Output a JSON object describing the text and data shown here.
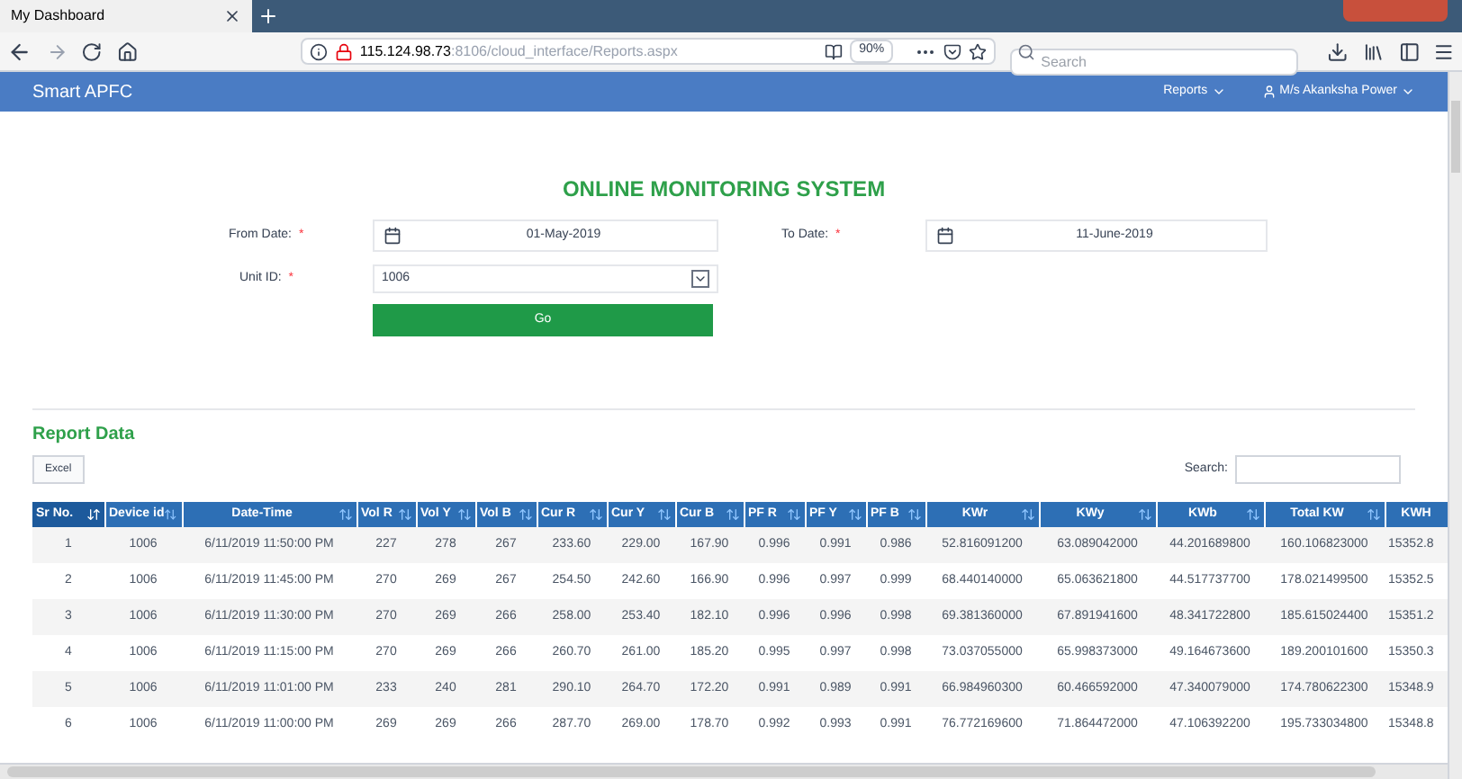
{
  "browser": {
    "tab_title": "My Dashboard",
    "address_host": "115.124.98.73",
    "address_path": ":8106/cloud_interface/Reports.aspx",
    "zoom": "90%",
    "search_placeholder": "Search"
  },
  "navbar": {
    "brand": "Smart APFC",
    "menus": [
      {
        "label": "Reports",
        "kind": "menu"
      },
      {
        "label": "M/s Akanksha Power",
        "kind": "user"
      }
    ]
  },
  "title": "ONLINE MONITORING SYSTEM",
  "form": {
    "from_label": "From Date: ",
    "from_value": "01-May-2019",
    "to_label": "To Date: ",
    "to_value": "11-June-2019",
    "unit_label": "Unit ID: ",
    "unit_value": "1006",
    "required_mark": "*",
    "go": "Go"
  },
  "report": {
    "heading": "Report Data",
    "excel": "Excel",
    "search_label": "Search:"
  },
  "table": {
    "columns": [
      {
        "label": "Sr No.",
        "sorted": true
      },
      {
        "label": "Device id",
        "sorted": false
      },
      {
        "label": "Date-Time",
        "sorted": false
      },
      {
        "label": "Vol R",
        "sorted": false
      },
      {
        "label": "Vol Y",
        "sorted": false
      },
      {
        "label": "Vol B",
        "sorted": false
      },
      {
        "label": "Cur R",
        "sorted": false
      },
      {
        "label": "Cur Y",
        "sorted": false
      },
      {
        "label": "Cur B",
        "sorted": false
      },
      {
        "label": "PF R",
        "sorted": false
      },
      {
        "label": "PF Y",
        "sorted": false
      },
      {
        "label": "PF B",
        "sorted": false
      },
      {
        "label": "KWr",
        "sorted": false
      },
      {
        "label": "KWy",
        "sorted": false
      },
      {
        "label": "KWb",
        "sorted": false
      },
      {
        "label": "Total KW",
        "sorted": false
      },
      {
        "label": "KWH"
      }
    ],
    "rows": [
      [
        "1",
        "1006",
        "6/11/2019 11:50:00 PM",
        "227",
        "278",
        "267",
        "233.60",
        "229.00",
        "167.90",
        "0.996",
        "0.991",
        "0.986",
        "52.816091200",
        "63.089042000",
        "44.201689800",
        "160.106823000",
        "15352.8"
      ],
      [
        "2",
        "1006",
        "6/11/2019 11:45:00 PM",
        "270",
        "269",
        "267",
        "254.50",
        "242.60",
        "166.90",
        "0.996",
        "0.997",
        "0.999",
        "68.440140000",
        "65.063621800",
        "44.517737700",
        "178.021499500",
        "15352.5"
      ],
      [
        "3",
        "1006",
        "6/11/2019 11:30:00 PM",
        "270",
        "269",
        "266",
        "258.00",
        "253.40",
        "182.10",
        "0.996",
        "0.996",
        "0.998",
        "69.381360000",
        "67.891941600",
        "48.341722800",
        "185.615024400",
        "15351.2"
      ],
      [
        "4",
        "1006",
        "6/11/2019 11:15:00 PM",
        "270",
        "269",
        "266",
        "260.70",
        "261.00",
        "185.20",
        "0.995",
        "0.997",
        "0.998",
        "73.037055000",
        "65.998373000",
        "49.164673600",
        "189.200101600",
        "15350.3"
      ],
      [
        "5",
        "1006",
        "6/11/2019 11:01:00 PM",
        "233",
        "240",
        "281",
        "290.10",
        "264.70",
        "172.20",
        "0.991",
        "0.989",
        "0.991",
        "66.984960300",
        "60.466592000",
        "47.340079000",
        "174.780622300",
        "15348.9"
      ],
      [
        "6",
        "1006",
        "6/11/2019 11:00:00 PM",
        "269",
        "269",
        "266",
        "287.70",
        "269.00",
        "178.70",
        "0.992",
        "0.993",
        "0.991",
        "76.772169600",
        "71.864472000",
        "47.106392200",
        "195.733034800",
        "15348.8"
      ]
    ]
  }
}
